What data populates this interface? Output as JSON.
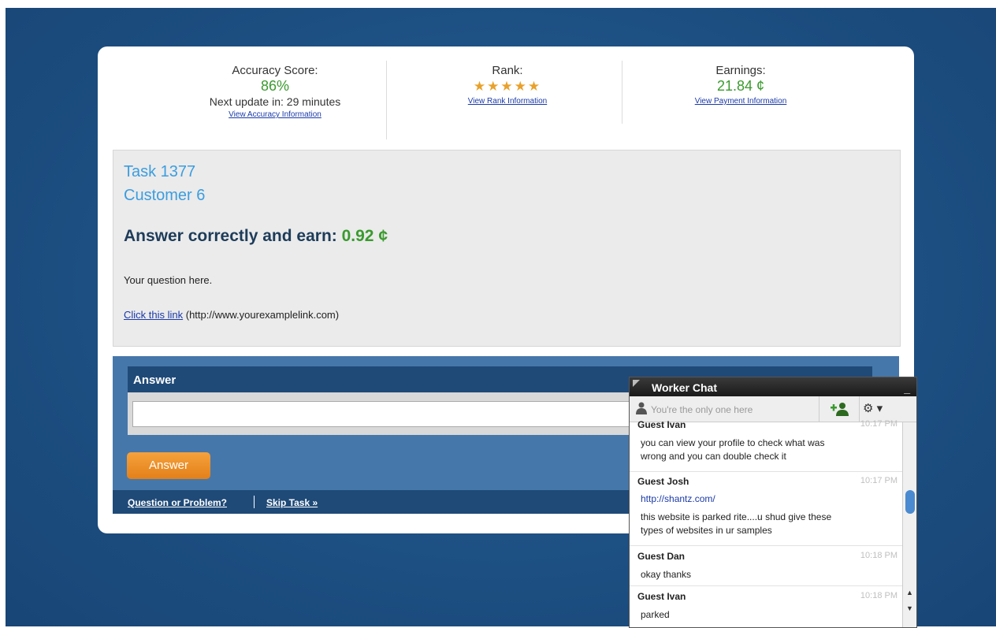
{
  "stats": {
    "accuracy": {
      "label": "Accuracy Score:",
      "value": "86%",
      "next_update": "Next update in: 29 minutes",
      "link": "View Accuracy Information"
    },
    "rank": {
      "label": "Rank:",
      "stars": "★★★★★",
      "star_count": 5,
      "link": "View Rank Information"
    },
    "earnings": {
      "label": "Earnings:",
      "value": "21.84 ¢",
      "link": "View Payment Information"
    }
  },
  "task": {
    "title": "Task 1377",
    "customer": "Customer 6",
    "earn_label": "Answer correctly and earn:",
    "earn_amount": "0.92 ¢",
    "question": "Your question here.",
    "link_text": "Click this link",
    "link_url": "(http://www.yourexamplelink.com)"
  },
  "answer": {
    "header": "Answer",
    "input_value": "",
    "button": "Answer",
    "problem_link": "Question or Problem?",
    "skip_link": "Skip Task »"
  },
  "chat": {
    "title": "Worker Chat",
    "minimize": "_",
    "placeholder": "You're the only one here",
    "messages": [
      {
        "who": "Guest Ivan",
        "time": "10:17 PM",
        "text": [
          "you can view your profile to check what was",
          "wrong and you can double check it"
        ]
      },
      {
        "who": "Guest Josh",
        "time": "10:17 PM",
        "url": "http://shantz.com/",
        "text": [
          "this website is parked rite....u shud give these",
          "types of websites in ur samples"
        ]
      },
      {
        "who": "Guest Dan",
        "time": "10:18 PM",
        "text": [
          "okay thanks"
        ]
      },
      {
        "who": "Guest Ivan",
        "time": "10:18 PM",
        "text": [
          "parked"
        ]
      }
    ]
  },
  "colors": {
    "accent_green": "#3a9a2e",
    "link_blue": "#3b9de0",
    "panel_blue": "#4677aa",
    "button_orange": "#f5a23c"
  }
}
